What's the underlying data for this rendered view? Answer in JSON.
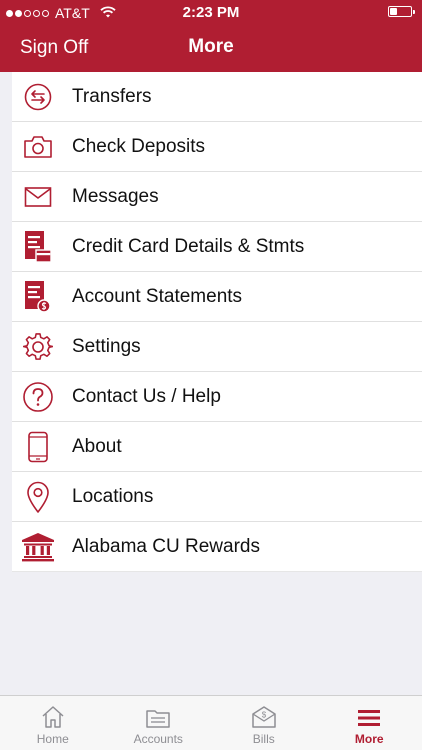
{
  "status_bar": {
    "carrier": "AT&T",
    "time": "2:23 PM",
    "signal_bars": 2,
    "battery_level": 0.35
  },
  "nav": {
    "left_button": "Sign Off",
    "title": "More"
  },
  "menu": {
    "items": [
      {
        "label": "Transfers",
        "icon": "transfer-icon"
      },
      {
        "label": "Check Deposits",
        "icon": "camera-icon"
      },
      {
        "label": "Messages",
        "icon": "envelope-icon"
      },
      {
        "label": "Credit Card Details & Stmts",
        "icon": "credit-card-statement-icon"
      },
      {
        "label": "Account Statements",
        "icon": "account-statement-icon"
      },
      {
        "label": "Settings",
        "icon": "gear-icon"
      },
      {
        "label": "Contact Us / Help",
        "icon": "question-icon"
      },
      {
        "label": "About",
        "icon": "phone-icon"
      },
      {
        "label": "Locations",
        "icon": "map-pin-icon"
      },
      {
        "label": "Alabama CU Rewards",
        "icon": "bank-icon"
      }
    ]
  },
  "tabs": [
    {
      "label": "Home",
      "icon": "home-icon",
      "active": false
    },
    {
      "label": "Accounts",
      "icon": "accounts-icon",
      "active": false
    },
    {
      "label": "Bills",
      "icon": "bills-icon",
      "active": false
    },
    {
      "label": "More",
      "icon": "menu-icon",
      "active": true
    }
  ],
  "colors": {
    "brand": "#b01e32",
    "background": "#efeff4",
    "inactive_tab": "#8e8e93"
  }
}
